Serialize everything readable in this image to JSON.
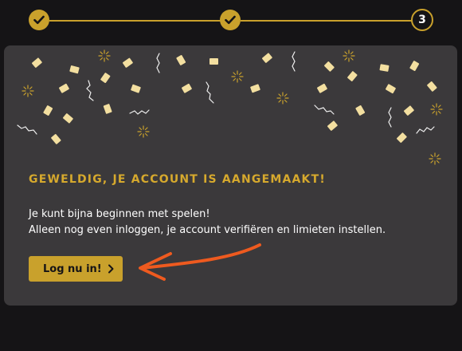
{
  "stepper": {
    "steps": [
      {
        "state": "completed",
        "icon": "checkmark-icon"
      },
      {
        "state": "completed",
        "icon": "checkmark-icon"
      },
      {
        "state": "current",
        "number": "3"
      }
    ]
  },
  "success": {
    "title": "GEWELDIG, JE ACCOUNT IS AANGEMAAKT!",
    "line1": "Je kunt bijna beginnen met spelen!",
    "line2": "Alleen nog even inloggen, je account verifiëren en limieten instellen."
  },
  "login_button": {
    "label": "Log nu in!",
    "icon": "chevron-right-icon"
  },
  "annotation": {
    "icon": "pointer-arrow-icon"
  },
  "colors": {
    "background": "#151416",
    "card": "#3b393b",
    "accent_gold": "#c9a12c",
    "title_gold": "#d6a92d",
    "annotation_orange": "#ee5a1f",
    "confetti": "#f3dfa0"
  }
}
